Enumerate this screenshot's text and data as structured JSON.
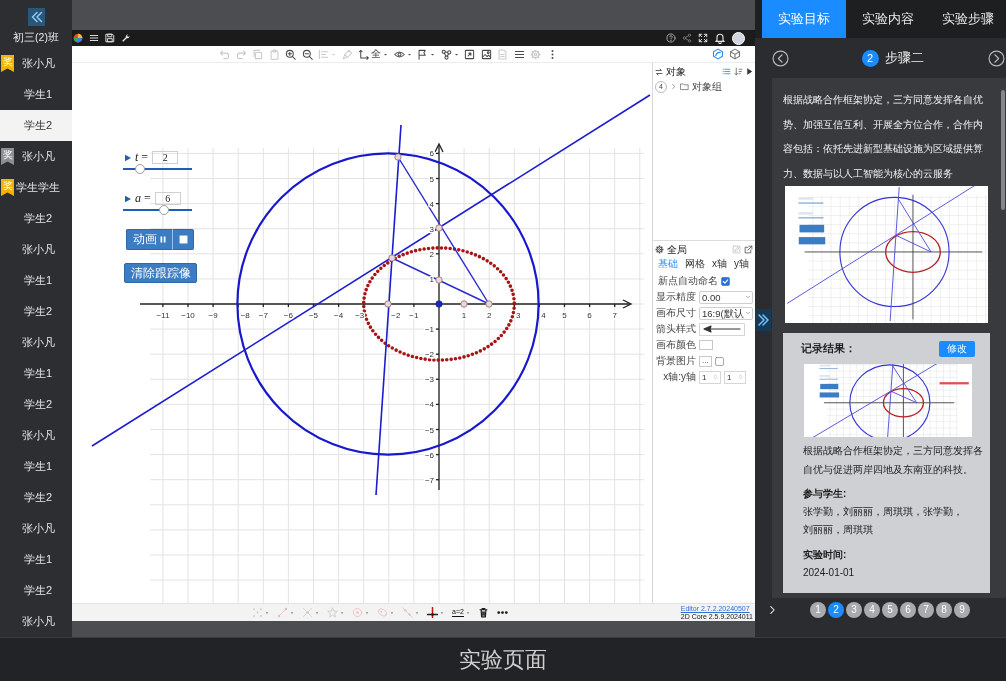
{
  "sidebar": {
    "class_name": "初三(2)班",
    "students": [
      {
        "name": "张小凡",
        "selected": false,
        "award": {
          "label": "奖",
          "color": "#f2b200"
        }
      },
      {
        "name": "学生1",
        "selected": false
      },
      {
        "name": "学生2",
        "selected": true
      },
      {
        "name": "张小凡",
        "selected": false,
        "award": {
          "label": "奖",
          "color": "#8d8f93"
        }
      },
      {
        "name": "学生学生",
        "selected": false,
        "award": {
          "label": "奖",
          "color": "#f2b200"
        }
      },
      {
        "name": "学生2",
        "selected": false
      },
      {
        "name": "张小凡",
        "selected": false
      },
      {
        "name": "学生1",
        "selected": false
      },
      {
        "name": "学生2",
        "selected": false
      },
      {
        "name": "张小凡",
        "selected": false
      },
      {
        "name": "学生1",
        "selected": false
      },
      {
        "name": "学生2",
        "selected": false
      },
      {
        "name": "张小凡",
        "selected": false
      },
      {
        "name": "学生1",
        "selected": false
      },
      {
        "name": "学生2",
        "selected": false
      },
      {
        "name": "张小凡",
        "selected": false
      },
      {
        "name": "学生1",
        "selected": false
      },
      {
        "name": "学生2",
        "selected": false
      },
      {
        "name": "张小凡",
        "selected": false
      }
    ]
  },
  "editor": {
    "toolbar": [
      {
        "kind": "undo",
        "disabled": true,
        "menu": false
      },
      {
        "kind": "redo",
        "disabled": true,
        "menu": false
      },
      {
        "kind": "copy",
        "disabled": true,
        "menu": false
      },
      {
        "kind": "paste",
        "disabled": true,
        "menu": false
      },
      {
        "kind": "zoom_in",
        "disabled": false,
        "menu": false
      },
      {
        "kind": "zoom_out",
        "disabled": false,
        "menu": false
      },
      {
        "kind": "align",
        "disabled": true,
        "menu": true
      },
      {
        "kind": "brush",
        "disabled": true,
        "menu": false
      },
      {
        "kind": "axes",
        "disabled": false,
        "menu": true,
        "label": "全"
      },
      {
        "kind": "eye",
        "disabled": false,
        "menu": true
      },
      {
        "kind": "flag",
        "disabled": false,
        "menu": true
      },
      {
        "kind": "cluster",
        "disabled": false,
        "menu": true
      },
      {
        "kind": "fit",
        "disabled": false,
        "menu": false
      },
      {
        "kind": "image",
        "disabled": false,
        "menu": false
      },
      {
        "kind": "doc",
        "disabled": true,
        "menu": false
      },
      {
        "kind": "list",
        "disabled": false,
        "menu": false
      },
      {
        "kind": "gear",
        "disabled": true,
        "menu": false
      },
      {
        "kind": "more",
        "disabled": false,
        "menu": false
      }
    ],
    "views": [
      {
        "kind": "graphics",
        "selected": true
      },
      {
        "kind": "solid",
        "selected": false
      }
    ],
    "sliders": [
      {
        "label": "*t* =",
        "value": "2",
        "level": 0.25
      },
      {
        "label": "*a* =",
        "value": "6",
        "level": 0.6
      }
    ],
    "animate_button": {
      "label": "动画",
      "playing": true
    },
    "clear_trace_button": {
      "label": "清除跟踪像"
    },
    "axes": {
      "x_labels": [
        "−11",
        "−10",
        "−9",
        "−8",
        "−7",
        "−6",
        "−5",
        "−4",
        "−3",
        "−2",
        "−1",
        "1",
        "2",
        "3",
        "4",
        "5",
        "6",
        "7"
      ],
      "y_labels": [
        "6",
        "5",
        "4",
        "3",
        "2",
        "1",
        "−1",
        "−2",
        "−3",
        "−4",
        "−5",
        "−6",
        "−7"
      ]
    },
    "objects_panel": {
      "title": "对象",
      "groups": [
        {
          "count": "4",
          "label": "对象组",
          "expanded": false
        }
      ]
    },
    "settings_panel": {
      "title": "全局",
      "tabs": [
        {
          "label": "基础",
          "selected": true
        },
        {
          "label": "网格",
          "selected": false
        },
        {
          "label": "x轴",
          "selected": false
        },
        {
          "label": "y轴",
          "selected": false
        }
      ],
      "rows": [
        {
          "kind": "checkbox",
          "label": "新点自动命名",
          "checked": true
        },
        {
          "kind": "select",
          "label": "显示精度",
          "value": "0.00"
        },
        {
          "kind": "select",
          "label": "画布尺寸",
          "value": "16:9(默认"
        },
        {
          "kind": "arrow",
          "label": "箭头样式"
        },
        {
          "kind": "color",
          "label": "画布颜色"
        },
        {
          "kind": "file",
          "label": "背景图片",
          "button": "...",
          "checked": false
        },
        {
          "kind": "ratio",
          "label": "x轴:y轴",
          "values": [
            "1",
            "1"
          ]
        }
      ]
    },
    "tools": [
      {
        "kind": "point",
        "selected": false,
        "disabled": true,
        "menu": true
      },
      {
        "kind": "segment",
        "selected": false,
        "disabled": true,
        "menu": true
      },
      {
        "kind": "intersect",
        "selected": false,
        "disabled": true,
        "menu": true
      },
      {
        "kind": "star",
        "selected": false,
        "disabled": true,
        "menu": true
      },
      {
        "kind": "circle",
        "selected": false,
        "disabled": true,
        "menu": true
      },
      {
        "kind": "polygon",
        "selected": false,
        "disabled": true,
        "menu": true
      },
      {
        "kind": "line",
        "selected": false,
        "disabled": true,
        "menu": true
      },
      {
        "kind": "perpendicular",
        "selected": false,
        "disabled": false,
        "menu": true
      },
      {
        "kind": "slider",
        "label": "a=2",
        "selected": false,
        "disabled": false,
        "menu": true
      },
      {
        "kind": "delete",
        "selected": false,
        "disabled": false,
        "menu": false
      },
      {
        "kind": "more",
        "selected": false,
        "disabled": false,
        "menu": false
      }
    ],
    "version": {
      "editor": "Editor 2.7.2.20240507",
      "core": "2D Core 2.5.9.2024011"
    }
  },
  "lesson_panel": {
    "tabs": [
      {
        "label": "实验目标",
        "selected": true
      },
      {
        "label": "实验内容",
        "selected": false
      },
      {
        "label": "实验步骤",
        "selected": false
      }
    ],
    "step": {
      "number": "2",
      "title": "步骤二"
    },
    "step_text": "根据战略合作框架协定，三方同意发挥各自优势、加强互信互利、开展全方位合作，合作内容包括：依托先进新型基础设施为区域提供算力、数据与以人工智能为核心的云服务",
    "record": {
      "title": "记录结果：",
      "edit_button": "修改",
      "summary": "根据战略合作框架协定，三方同意发挥各自优与促进两岸四地及东南亚的科技。",
      "participants_label": "参与学生:",
      "participants": "张学勤，刘丽丽，周琪琪，张学勤，刘丽丽，周琪琪",
      "time_label": "实验时间:",
      "time": "2024-01-01"
    },
    "pages": [
      {
        "label": "1",
        "selected": false
      },
      {
        "label": "2",
        "selected": true
      },
      {
        "label": "3",
        "selected": false
      },
      {
        "label": "4",
        "selected": false
      },
      {
        "label": "5",
        "selected": false
      },
      {
        "label": "6",
        "selected": false
      },
      {
        "label": "7",
        "selected": false
      },
      {
        "label": "8",
        "selected": false
      },
      {
        "label": "9",
        "selected": false
      }
    ]
  },
  "caption": "实验页面"
}
